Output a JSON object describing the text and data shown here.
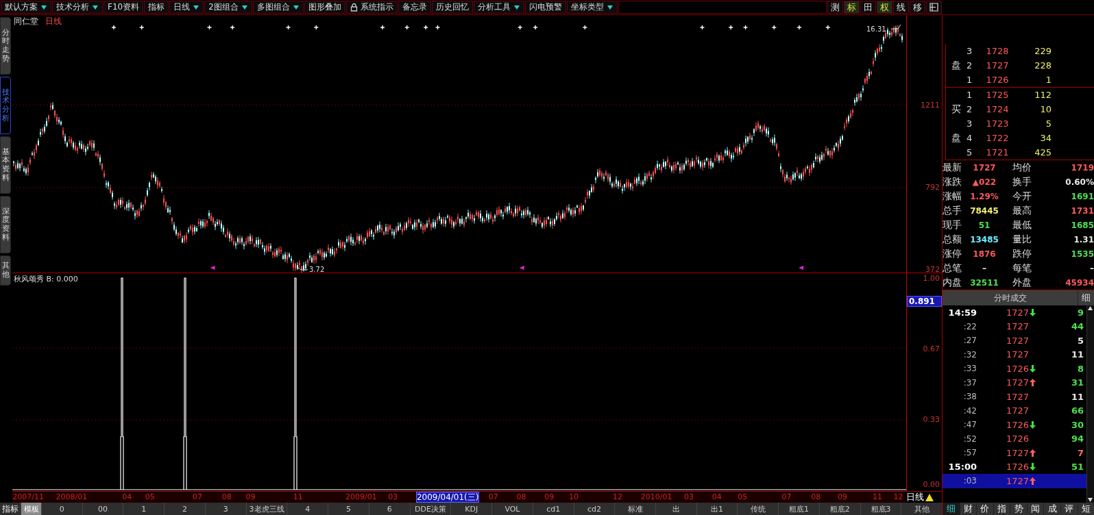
{
  "menu": [
    {
      "kind": "menu",
      "label": "默认方案",
      "dropdown": true
    },
    {
      "kind": "menu",
      "label": "技术分析",
      "dropdown": true
    },
    {
      "kind": "menu",
      "label": "F10资料",
      "dropdown": false
    },
    {
      "kind": "menu",
      "label": "指标",
      "dropdown": false
    },
    {
      "kind": "menu",
      "label": "日线",
      "dropdown": true
    },
    {
      "kind": "menu",
      "label": "2图组合",
      "dropdown": true
    },
    {
      "kind": "menu",
      "label": "多图组合",
      "dropdown": true
    },
    {
      "kind": "menu",
      "label": "图形叠加",
      "dropdown": false
    },
    {
      "kind": "locked",
      "label": "系统指示",
      "dropdown": false
    },
    {
      "kind": "menu",
      "label": "备忘录",
      "dropdown": false
    },
    {
      "kind": "menu",
      "label": "历史回忆",
      "dropdown": false
    },
    {
      "kind": "menu",
      "label": "分析工具",
      "dropdown": true
    },
    {
      "kind": "menu",
      "label": "闪电预警",
      "dropdown": false
    },
    {
      "kind": "menu",
      "label": "坐标类型",
      "dropdown": true
    }
  ],
  "tools": [
    {
      "label": "测",
      "selected": false
    },
    {
      "label": "标",
      "selected": true
    },
    {
      "label": "田",
      "selected": false
    },
    {
      "label": "权",
      "selected": true
    },
    {
      "label": "线",
      "selected": false
    },
    {
      "label": "移",
      "selected": false
    }
  ],
  "side_tabs": [
    {
      "label": "分时走势",
      "selected": false
    },
    {
      "label": "技术分析",
      "selected": true
    },
    {
      "label": "基本资料",
      "selected": false
    },
    {
      "label": "深度资料",
      "selected": false
    },
    {
      "label": "其他",
      "selected": false
    }
  ],
  "chart": {
    "stock": "同仁堂",
    "period": "日线",
    "high_label": "16.31",
    "low_label": "3.72",
    "axis_labels": [
      "1211",
      "792",
      "372"
    ]
  },
  "indicator": {
    "title": "秋风颂秀 B: 0.000",
    "axis_labels": [
      "1.00",
      "0.67",
      "0.33",
      "0.00"
    ],
    "cursor_value": "0.891"
  },
  "dates": [
    {
      "label": "2007/11",
      "selected": false
    },
    {
      "label": "2008/01",
      "selected": false
    },
    {
      "label": "04",
      "selected": false
    },
    {
      "label": "05",
      "selected": false
    },
    {
      "label": "07",
      "selected": false
    },
    {
      "label": "08",
      "selected": false
    },
    {
      "label": "09",
      "selected": false
    },
    {
      "label": "11",
      "selected": false
    },
    {
      "label": "2009/01",
      "selected": false
    },
    {
      "label": "03",
      "selected": false
    },
    {
      "label": "2009/04/01(三)",
      "selected": true
    },
    {
      "label": "07",
      "selected": false
    },
    {
      "label": "08",
      "selected": false
    },
    {
      "label": "09",
      "selected": false
    },
    {
      "label": "10",
      "selected": false
    },
    {
      "label": "12",
      "selected": false
    },
    {
      "label": "2010/01",
      "selected": false
    },
    {
      "label": "03",
      "selected": false
    },
    {
      "label": "04",
      "selected": false
    },
    {
      "label": "05",
      "selected": false
    },
    {
      "label": "07",
      "selected": false
    },
    {
      "label": "08",
      "selected": false
    },
    {
      "label": "09",
      "selected": false
    },
    {
      "label": "11",
      "selected": false
    },
    {
      "label": "12",
      "selected": false
    }
  ],
  "period_label": "日线",
  "template_bar": {
    "label": "指标",
    "tabs": [
      {
        "label": "模板",
        "selected": true
      },
      {
        "label": "0",
        "selected": false
      },
      {
        "label": "00",
        "selected": false
      },
      {
        "label": "1",
        "selected": false
      },
      {
        "label": "2",
        "selected": false
      },
      {
        "label": "3",
        "selected": false
      },
      {
        "label": "3老虎三线",
        "selected": false
      },
      {
        "label": "4",
        "selected": false
      },
      {
        "label": "5",
        "selected": false
      },
      {
        "label": "6",
        "selected": false
      },
      {
        "label": "DDE决策",
        "selected": false
      },
      {
        "label": "KDJ",
        "selected": false
      },
      {
        "label": "VOL",
        "selected": false
      },
      {
        "label": "cd1",
        "selected": false
      },
      {
        "label": "cd2",
        "selected": false
      },
      {
        "label": "标准",
        "selected": false
      },
      {
        "label": "出",
        "selected": false
      },
      {
        "label": "出1",
        "selected": false
      },
      {
        "label": "传统",
        "selected": false
      },
      {
        "label": "粗底1",
        "selected": false
      },
      {
        "label": "粗底2",
        "selected": false
      },
      {
        "label": "粗底3",
        "selected": false
      },
      {
        "label": "其他",
        "selected": false
      }
    ]
  },
  "order_book": {
    "sell": {
      "label_chars": [
        "盘"
      ],
      "rows": [
        {
          "rank": "3",
          "price": "1728",
          "volume": "229"
        },
        {
          "rank": "2",
          "price": "1727",
          "volume": "228"
        },
        {
          "rank": "1",
          "price": "1726",
          "volume": "1"
        }
      ]
    },
    "buy": {
      "label_chars": [
        "买",
        "盘"
      ],
      "rows": [
        {
          "rank": "1",
          "price": "1725",
          "volume": "112"
        },
        {
          "rank": "2",
          "price": "1724",
          "volume": "10"
        },
        {
          "rank": "3",
          "price": "1723",
          "volume": "5"
        },
        {
          "rank": "4",
          "price": "1722",
          "volume": "34"
        },
        {
          "rank": "5",
          "price": "1721",
          "volume": "425"
        }
      ]
    }
  },
  "stats": [
    {
      "label": "最新",
      "value": "1727",
      "color": "#ff5a5a"
    },
    {
      "label": "均价",
      "value": "1719",
      "color": "#ff5a5a"
    },
    {
      "label": "涨跌",
      "value": "▲022",
      "color": "#ff5a5a"
    },
    {
      "label": "换手",
      "value": "0.60%",
      "color": "#e8e8e8"
    },
    {
      "label": "涨幅",
      "value": "1.29%",
      "color": "#ff5a5a"
    },
    {
      "label": "今开",
      "value": "1691",
      "color": "#4fe04f"
    },
    {
      "label": "总手",
      "value": "78445",
      "color": "#f0f070"
    },
    {
      "label": "最高",
      "value": "1731",
      "color": "#ff5a5a"
    },
    {
      "label": "现手",
      "value": "51",
      "color": "#4fe04f"
    },
    {
      "label": "最低",
      "value": "1685",
      "color": "#4fe04f"
    },
    {
      "label": "总额",
      "value": "13485",
      "color": "#6ff0ff"
    },
    {
      "label": "量比",
      "value": "1.31",
      "color": "#e8e8e8"
    },
    {
      "label": "涨停",
      "value": "1876",
      "color": "#ff5a5a"
    },
    {
      "label": "跌停",
      "value": "1535",
      "color": "#4fe04f"
    },
    {
      "label": "总笔",
      "value": "–",
      "color": "#e8e8e8"
    },
    {
      "label": "每笔",
      "value": "–",
      "color": "#e8e8e8"
    },
    {
      "label": "内盘",
      "value": "32511",
      "color": "#4fe04f"
    },
    {
      "label": "外盘",
      "value": "45934",
      "color": "#ff5a5a"
    }
  ],
  "ticks": {
    "title": "分时成交",
    "detail_button": "细",
    "rows": [
      {
        "kind": "hour",
        "time": "14:59",
        "price": "1727",
        "up_arrow": false,
        "down_arrow": true,
        "volume": "9",
        "color": "#4fe04f",
        "selected": false
      },
      {
        "kind": "minute",
        "time": ":22",
        "price": "1727",
        "up_arrow": false,
        "down_arrow": false,
        "volume": "44",
        "color": "#4fe04f",
        "selected": false
      },
      {
        "kind": "minute",
        "time": ":27",
        "price": "1727",
        "up_arrow": false,
        "down_arrow": false,
        "volume": "5",
        "color": "#e8e8e8",
        "selected": false
      },
      {
        "kind": "minute",
        "time": ":32",
        "price": "1727",
        "up_arrow": false,
        "down_arrow": false,
        "volume": "11",
        "color": "#e8e8e8",
        "selected": false
      },
      {
        "kind": "minute",
        "time": ":33",
        "price": "1726",
        "up_arrow": false,
        "down_arrow": true,
        "volume": "8",
        "color": "#4fe04f",
        "selected": false
      },
      {
        "kind": "minute",
        "time": ":37",
        "price": "1727",
        "up_arrow": true,
        "down_arrow": false,
        "volume": "31",
        "color": "#4fe04f",
        "selected": false
      },
      {
        "kind": "minute",
        "time": ":38",
        "price": "1727",
        "up_arrow": false,
        "down_arrow": false,
        "volume": "11",
        "color": "#e8e8e8",
        "selected": false
      },
      {
        "kind": "minute",
        "time": ":42",
        "price": "1727",
        "up_arrow": false,
        "down_arrow": false,
        "volume": "66",
        "color": "#4fe04f",
        "selected": false
      },
      {
        "kind": "minute",
        "time": ":47",
        "price": "1726",
        "up_arrow": false,
        "down_arrow": true,
        "volume": "30",
        "color": "#4fe04f",
        "selected": false
      },
      {
        "kind": "minute",
        "time": ":52",
        "price": "1726",
        "up_arrow": false,
        "down_arrow": false,
        "volume": "94",
        "color": "#4fe04f",
        "selected": false
      },
      {
        "kind": "minute",
        "time": ":57",
        "price": "1727",
        "up_arrow": true,
        "down_arrow": false,
        "volume": "7",
        "color": "#ff6a6a",
        "selected": false
      },
      {
        "kind": "hour",
        "time": "15:00",
        "price": "1726",
        "up_arrow": false,
        "down_arrow": true,
        "volume": "51",
        "color": "#4fe04f",
        "selected": false
      },
      {
        "kind": "minute",
        "time": ":03",
        "price": "1727",
        "up_arrow": true,
        "down_arrow": false,
        "selected": true
      }
    ]
  },
  "quote_tabs": [
    {
      "label": "细",
      "selected": true
    },
    {
      "label": "财",
      "selected": false
    },
    {
      "label": "价",
      "selected": false
    },
    {
      "label": "指",
      "selected": false
    },
    {
      "label": "势",
      "selected": false
    },
    {
      "label": "闻",
      "selected": false
    },
    {
      "label": "成",
      "selected": false
    },
    {
      "label": "评",
      "selected": false
    },
    {
      "label": "短",
      "selected": false
    }
  ]
}
